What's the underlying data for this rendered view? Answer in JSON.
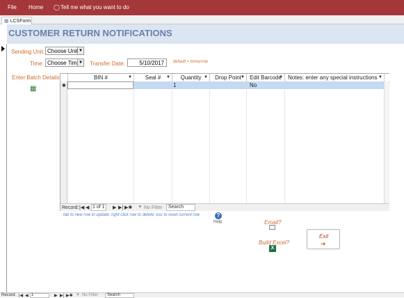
{
  "ribbon": {
    "file": "File",
    "home": "Home",
    "tell_me": "Tell me what you want to do"
  },
  "tab": {
    "label": "LCSForm"
  },
  "form": {
    "title": "CUSTOMER RETURN NOTIFICATIONS",
    "sending_unit": {
      "label": "Sending Unit:",
      "value": "Choose Unit"
    },
    "time": {
      "label": "Time:",
      "value": "Choose Time"
    },
    "transfer_date": {
      "label": "Transfer Date:",
      "value": "5/10/2017",
      "note": "default = tomorrow"
    },
    "batch_label": "Enter Batch Details"
  },
  "grid": {
    "columns": [
      "BIN #",
      "Seal #",
      "Quantity",
      "Drop Point",
      "Edit Barcode",
      "Notes: enter any special instructions"
    ],
    "new_row": {
      "quantity": "1",
      "edit_barcode": "No"
    },
    "nav": {
      "record_label": "Record:",
      "position": "1 of 1",
      "filter": "No Filter",
      "search": "Search"
    }
  },
  "hint": "tab to new row to update; right click row to delete; esc to reset current row",
  "help_label": "Help",
  "email_label": "Email?",
  "excel_label": "Build Excel?",
  "exit_label": "Exit",
  "bottom_nav": {
    "record_label": "Record:",
    "position": "1",
    "filter": "No Filter",
    "search": "Search"
  },
  "colors": {
    "ribbon": "#a4373a",
    "title": "#6b7fa6",
    "label": "#d06b2b",
    "selected_row": "#c5d9f1"
  }
}
